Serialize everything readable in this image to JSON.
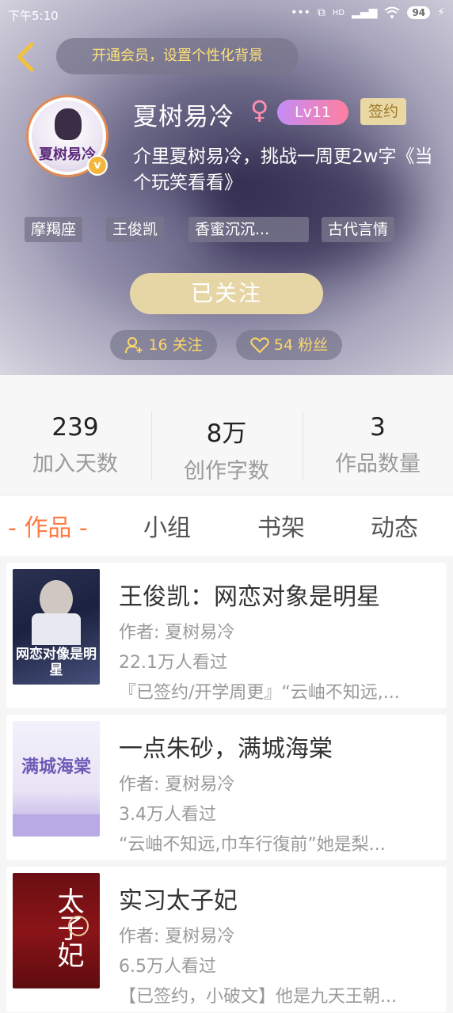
{
  "status_bar": {
    "time": "下午5:10",
    "network": "HD",
    "battery": "94"
  },
  "header": {
    "vip_prompt": "开通会员，设置个性化背景",
    "avatar_text": "夏树易冷",
    "user_name": "夏树易冷",
    "gender_symbol": "♀",
    "level": "Lv11",
    "signed_badge": "签约",
    "bio": "介里夏树易冷，挑战一周更2w字《当个玩笑看看》",
    "tags": [
      "摩羯座",
      "王俊凯",
      "香蜜沉沉...",
      "古代言情"
    ],
    "follow_button": "已关注",
    "following_count": "16 关注",
    "fans_count": "54 粉丝"
  },
  "stats": [
    {
      "value": "239",
      "label": "加入天数"
    },
    {
      "value": "8万",
      "label": "创作字数"
    },
    {
      "value": "3",
      "label": "作品数量"
    }
  ],
  "tabs": [
    {
      "label": "- 作品 -",
      "active": true
    },
    {
      "label": "小组",
      "active": false
    },
    {
      "label": "书架",
      "active": false
    },
    {
      "label": "动态",
      "active": false
    }
  ],
  "works": [
    {
      "title": "王俊凯：网恋对象是明星",
      "author": "作者: 夏树易冷",
      "views": "22.1万人看过",
      "desc": "『已签约/开学周更』“云岫不知远,...",
      "cover_text": "网恋对像是明星"
    },
    {
      "title": "一点朱砂，满城海棠",
      "author": "作者: 夏树易冷",
      "views": "3.4万人看过",
      "desc": "“云岫不知远,巾车行復前”她是梨...",
      "cover_text": "满城海棠"
    },
    {
      "title": "实习太子妃",
      "author": "作者: 夏树易冷",
      "views": "6.5万人看过",
      "desc": "【已签约，小破文】他是九天王朝...",
      "cover_text": "太子妃"
    }
  ],
  "colors": {
    "accent": "#ff7b45",
    "follow_gold": "#e6d6a6",
    "gold_text": "#ffd66a"
  }
}
